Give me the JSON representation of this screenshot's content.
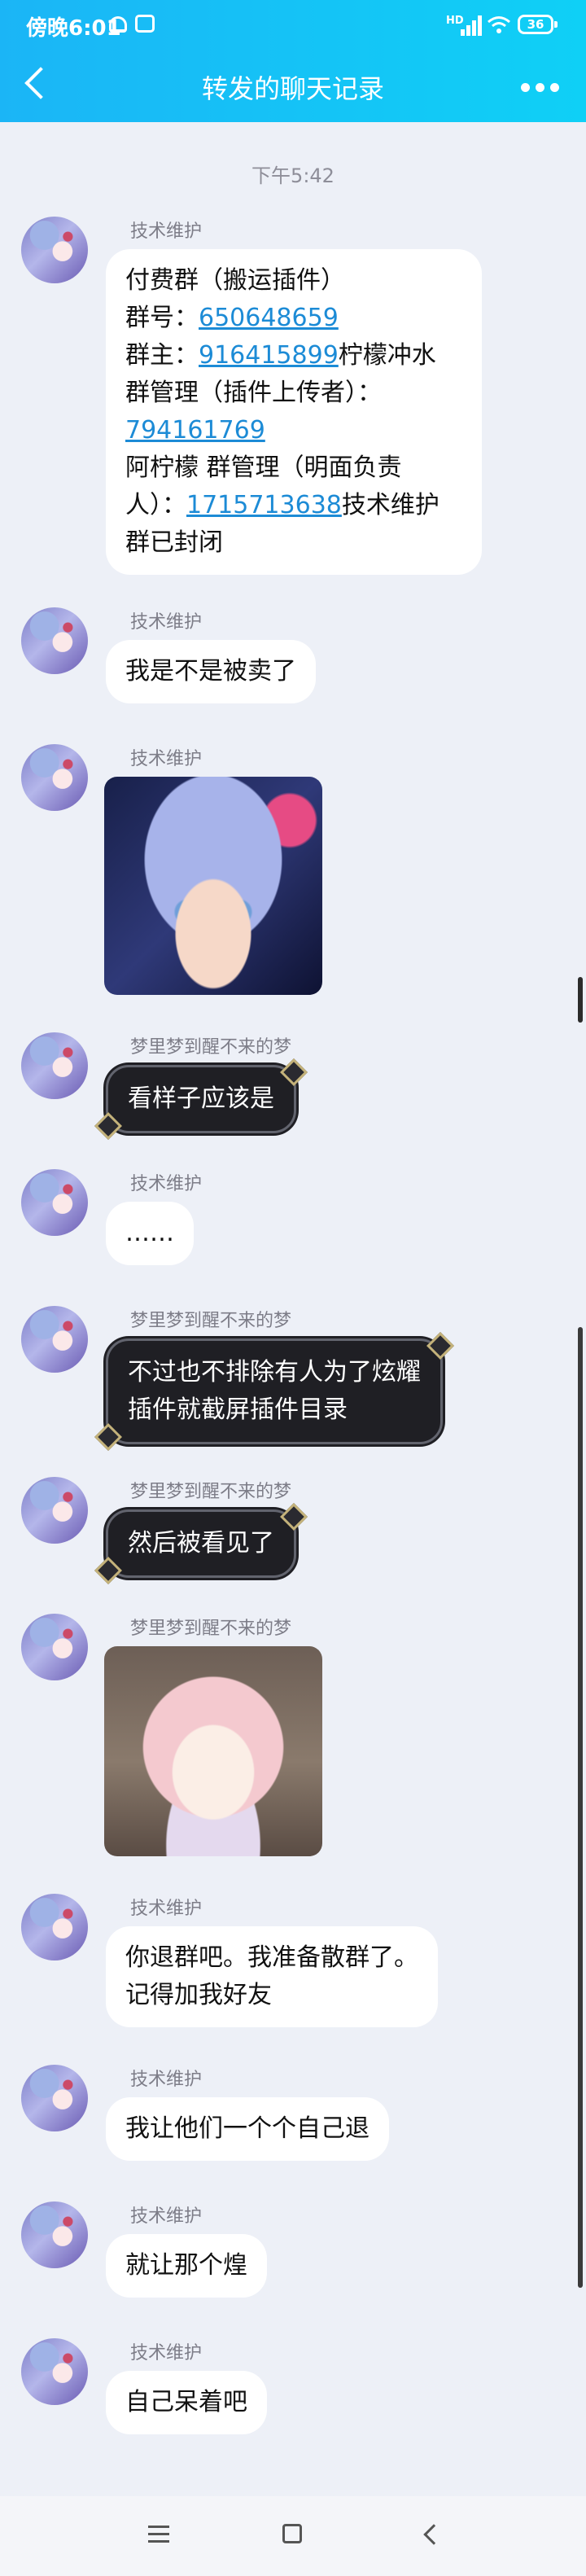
{
  "status_bar": {
    "time": "傍晚6:01",
    "network": "HD",
    "battery": "36"
  },
  "header": {
    "title": "转发的聊天记录",
    "back_icon": "chevron-left-icon",
    "more_icon": "more-dots-icon"
  },
  "chat": {
    "timestamp": "下午5:42",
    "messages": [
      {
        "sender": "技术维护",
        "lines": [
          [
            "付费群（搬运插件）"
          ],
          [
            "群号：",
            {
              "link": "650648659"
            }
          ],
          [
            "群主：",
            {
              "link": "916415899"
            },
            "柠檬冲水"
          ],
          [
            "群管理（插件上传者）："
          ],
          [
            {
              "link": "794161769"
            }
          ],
          [
            "阿柠檬 群管理（明面负责"
          ],
          [
            "人）：",
            {
              "link": "1715713638"
            },
            "技术维护"
          ],
          [
            "群已封闭"
          ]
        ]
      },
      {
        "sender": "技术维护",
        "text": "我是不是被卖了"
      },
      {
        "sender": "技术维护",
        "image": "anime-girl-sticker"
      },
      {
        "sender": "梦里梦到醒不来的梦",
        "text": "看样子应该是"
      },
      {
        "sender": "技术维护",
        "text": "……"
      },
      {
        "sender": "梦里梦到醒不来的梦",
        "line1": "不过也不排除有人为了炫耀",
        "line2": "插件就截屏插件目录"
      },
      {
        "sender": "梦里梦到醒不来的梦",
        "text": "然后被看见了"
      },
      {
        "sender": "梦里梦到醒不来的梦",
        "image": "crying-anime-girl-sticker"
      },
      {
        "sender": "技术维护",
        "line1": "你退群吧。我准备散群了。",
        "line2": "记得加我好友"
      },
      {
        "sender": "技术维护",
        "text": "我让他们一个个自己退"
      },
      {
        "sender": "技术维护",
        "text": "就让那个煌"
      },
      {
        "sender": "技术维护",
        "text": "自己呆着吧"
      }
    ]
  },
  "system_nav": {
    "menu_icon": "menu-lines-icon",
    "home_icon": "home-square-icon",
    "back_icon": "back-triangle-icon"
  },
  "colors": {
    "header_gradient_start": "#1bb5f6",
    "header_gradient_end": "#0fd0f6",
    "background": "#edf0f7",
    "link": "#1c8bd6",
    "dark_bubble": "#1f1f24"
  }
}
